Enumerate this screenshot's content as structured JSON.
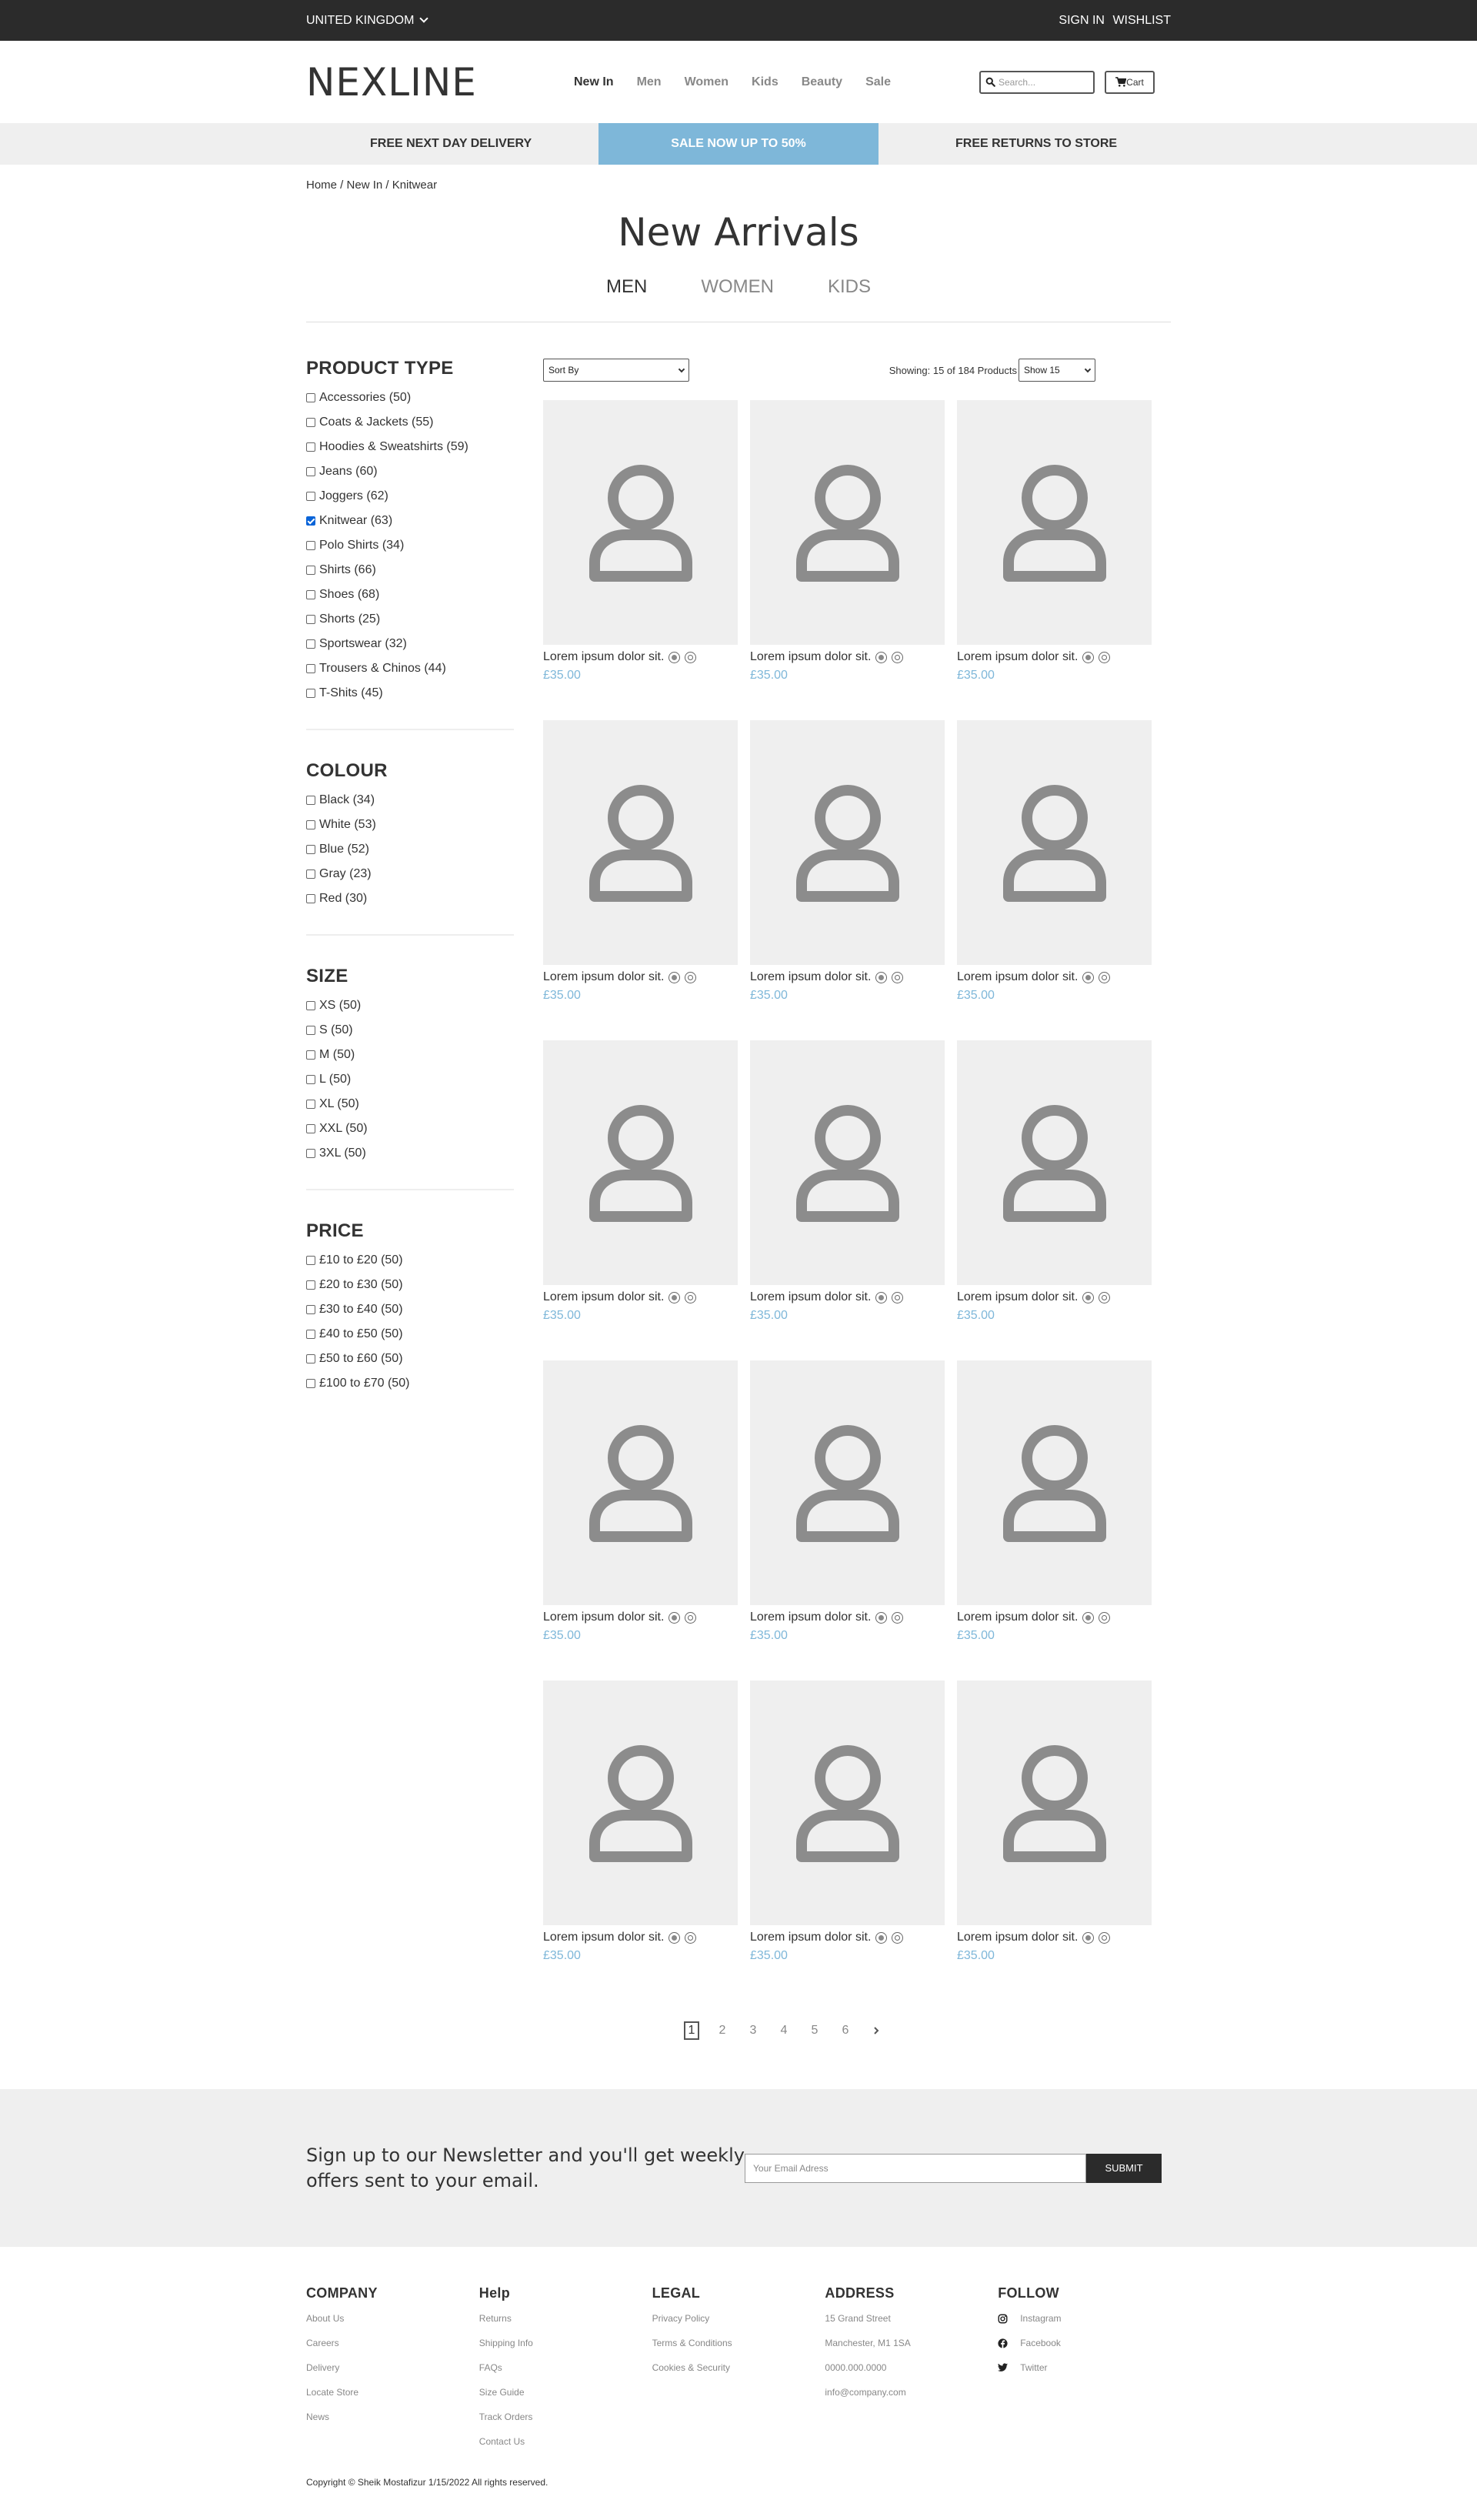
{
  "topbar": {
    "country": "UNITED KINGDOM",
    "sign_in": "SIGN IN",
    "wishlist": "WISHLIST"
  },
  "header": {
    "logo": "NEXLINE",
    "nav": [
      "New In",
      "Men",
      "Women",
      "Kids",
      "Beauty",
      "Sale"
    ],
    "active_nav": "New In",
    "search_placeholder": "Search...",
    "cart_label": "Cart"
  },
  "promo": {
    "left": "FREE NEXT DAY DELIVERY",
    "middle": "SALE NOW UP TO 50%",
    "right": "FREE RETURNS TO STORE",
    "highlight_color": "#7eb7d9"
  },
  "breadcrumb": "Home / New In / Knitwear",
  "page_title": "New Arrivals",
  "tabs": [
    "MEN",
    "WOMEN",
    "KIDS"
  ],
  "active_tab": "MEN",
  "filters": {
    "product_type": {
      "title": "PRODUCT TYPE",
      "items": [
        {
          "label": "Accessories (50)",
          "checked": false
        },
        {
          "label": "Coats & Jackets (55)",
          "checked": false
        },
        {
          "label": "Hoodies & Sweatshirts (59)",
          "checked": false
        },
        {
          "label": "Jeans (60)",
          "checked": false
        },
        {
          "label": "Joggers (62)",
          "checked": false
        },
        {
          "label": "Knitwear (63)",
          "checked": true
        },
        {
          "label": "Polo Shirts (34)",
          "checked": false
        },
        {
          "label": "Shirts (66)",
          "checked": false
        },
        {
          "label": "Shoes (68)",
          "checked": false
        },
        {
          "label": "Shorts (25)",
          "checked": false
        },
        {
          "label": "Sportswear (32)",
          "checked": false
        },
        {
          "label": "Trousers & Chinos (44)",
          "checked": false
        },
        {
          "label": "T-Shits (45)",
          "checked": false
        }
      ]
    },
    "colour": {
      "title": "COLOUR",
      "items": [
        {
          "label": "Black (34)",
          "checked": false
        },
        {
          "label": "White (53)",
          "checked": false
        },
        {
          "label": "Blue (52)",
          "checked": false
        },
        {
          "label": "Gray (23)",
          "checked": false
        },
        {
          "label": "Red (30)",
          "checked": false
        }
      ]
    },
    "size": {
      "title": "SIZE",
      "items": [
        {
          "label": "XS (50)",
          "checked": false
        },
        {
          "label": "S (50)",
          "checked": false
        },
        {
          "label": "M (50)",
          "checked": false
        },
        {
          "label": "L (50)",
          "checked": false
        },
        {
          "label": "XL (50)",
          "checked": false
        },
        {
          "label": "XXL (50)",
          "checked": false
        },
        {
          "label": "3XL (50)",
          "checked": false
        }
      ]
    },
    "price": {
      "title": "PRICE",
      "items": [
        {
          "label": "£10 to £20 (50)",
          "checked": false
        },
        {
          "label": "£20 to £30 (50)",
          "checked": false
        },
        {
          "label": "£30 to £40 (50)",
          "checked": false
        },
        {
          "label": "£40 to £50 (50)",
          "checked": false
        },
        {
          "label": "£50 to £60 (50)",
          "checked": false
        },
        {
          "label": "£100 to £70 (50)",
          "checked": false
        }
      ]
    }
  },
  "toolbar": {
    "sort_label": "Sort By",
    "showing": "Showing: 15 of 184 Products",
    "show_label": "Show 15"
  },
  "products": [
    {
      "name": "Lorem ipsum dolor sit.",
      "price": "£35.00",
      "icon": "user-placeholder-icon"
    },
    {
      "name": "Lorem ipsum dolor sit.",
      "price": "£35.00",
      "icon": "user-placeholder-icon"
    },
    {
      "name": "Lorem ipsum dolor sit.",
      "price": "£35.00",
      "icon": "user-placeholder-icon"
    },
    {
      "name": "Lorem ipsum dolor sit.",
      "price": "£35.00",
      "icon": "user-placeholder-icon"
    },
    {
      "name": "Lorem ipsum dolor sit.",
      "price": "£35.00",
      "icon": "user-placeholder-icon"
    },
    {
      "name": "Lorem ipsum dolor sit.",
      "price": "£35.00",
      "icon": "user-placeholder-icon"
    },
    {
      "name": "Lorem ipsum dolor sit.",
      "price": "£35.00",
      "icon": "user-placeholder-icon"
    },
    {
      "name": "Lorem ipsum dolor sit.",
      "price": "£35.00",
      "icon": "user-placeholder-icon"
    },
    {
      "name": "Lorem ipsum dolor sit.",
      "price": "£35.00",
      "icon": "user-placeholder-icon"
    },
    {
      "name": "Lorem ipsum dolor sit.",
      "price": "£35.00",
      "icon": "user-placeholder-icon"
    },
    {
      "name": "Lorem ipsum dolor sit.",
      "price": "£35.00",
      "icon": "user-placeholder-icon"
    },
    {
      "name": "Lorem ipsum dolor sit.",
      "price": "£35.00",
      "icon": "user-placeholder-icon"
    },
    {
      "name": "Lorem ipsum dolor sit.",
      "price": "£35.00",
      "icon": "user-placeholder-icon"
    },
    {
      "name": "Lorem ipsum dolor sit.",
      "price": "£35.00",
      "icon": "user-placeholder-icon"
    },
    {
      "name": "Lorem ipsum dolor sit.",
      "price": "£35.00",
      "icon": "user-placeholder-icon"
    }
  ],
  "price_color": "#7eb7d9",
  "pagination": {
    "pages": [
      "1",
      "2",
      "3",
      "4",
      "5",
      "6"
    ],
    "active": "1",
    "next_icon": "chevron-right-icon"
  },
  "newsletter": {
    "text": "Sign up to our Newsletter and you'll get weekly offers sent to your email.",
    "placeholder": "Your Email Adress",
    "submit": "SUBMIT"
  },
  "footer": {
    "columns": [
      {
        "title": "COMPANY",
        "links": [
          "About Us",
          "Careers",
          "Delivery",
          "Locate Store",
          "News"
        ]
      },
      {
        "title": "Help",
        "links": [
          "Returns",
          "Shipping Info",
          "FAQs",
          "Size Guide",
          "Track Orders",
          "Contact Us"
        ]
      },
      {
        "title": "LEGAL",
        "links": [
          "Privacy Policy",
          "Terms & Conditions",
          "Cookies & Security"
        ]
      },
      {
        "title": "ADDRESS",
        "links": [
          "15 Grand Street",
          "Manchester, M1 1SA",
          "0000.000.0000",
          "info@company.com"
        ]
      },
      {
        "title": "FOLLOW",
        "links": [
          "Instagram",
          "Facebook",
          "Twitter"
        ],
        "icons": [
          "instagram-icon",
          "facebook-icon",
          "twitter-icon"
        ]
      }
    ],
    "copyright": "Copyright © Sheik Mostafizur 1/15/2022 All rights reserved."
  }
}
